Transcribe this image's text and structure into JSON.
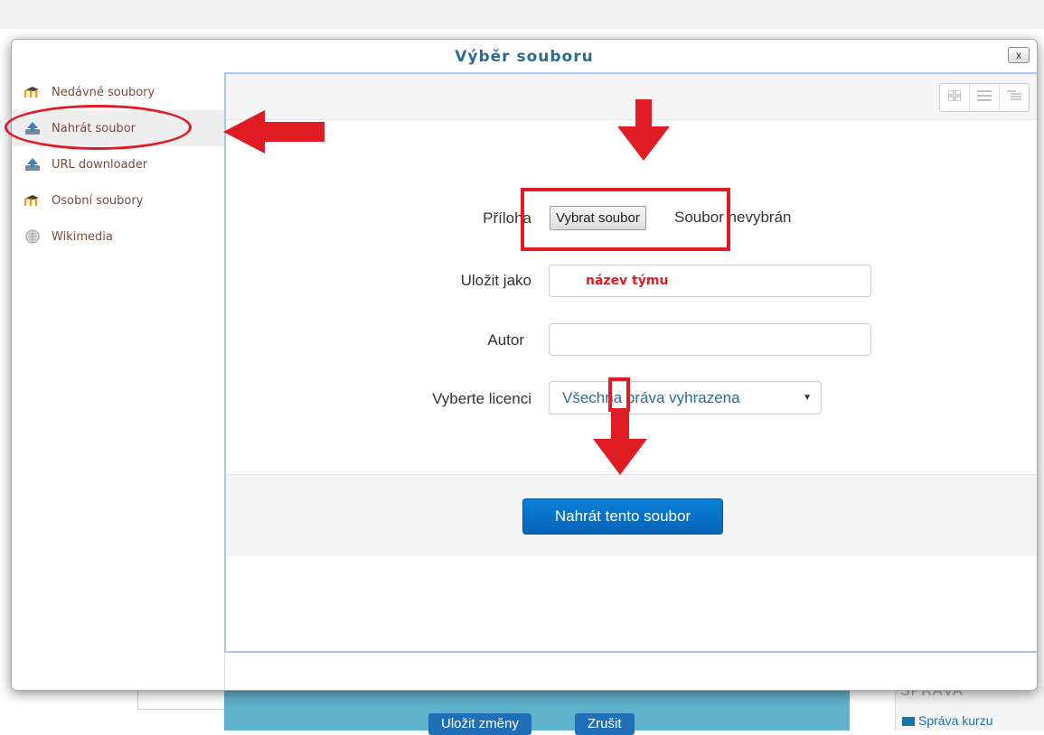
{
  "dialog": {
    "title": "Výběr souboru",
    "close_label": "x"
  },
  "sidebar": {
    "items": [
      {
        "label": "Nedávné soubory",
        "icon": "moodle-icon"
      },
      {
        "label": "Nahrát soubor",
        "icon": "upload-icon",
        "active": true
      },
      {
        "label": "URL downloader",
        "icon": "upload-icon"
      },
      {
        "label": "Osobní soubory",
        "icon": "moodle-icon"
      },
      {
        "label": "Wikimedia",
        "icon": "wikimedia-icon"
      }
    ]
  },
  "toolbar": {
    "views": [
      "icons-view-icon",
      "list-view-icon",
      "tree-view-icon"
    ]
  },
  "form": {
    "attachment_label": "Příloha",
    "choose_file_label": "Vybrat soubor",
    "file_status": "Soubor nevybrán",
    "save_as_label": "Uložit jako",
    "save_as_value": "název týmu",
    "author_label": "Autor",
    "author_value": "",
    "license_label": "Vyberte licenci",
    "license_value": "Všechna práva vyhrazena",
    "submit_label": "Nahrát tento soubor"
  },
  "background": {
    "save_changes_label": "Uložit změny",
    "cancel_label": "Zrušit",
    "admin_title": "SPRÁVA",
    "admin_item": "Správa kurzu"
  },
  "colors": {
    "accent_blue": "#0564b8",
    "annotation_red": "#e01b24",
    "title_blue": "#2b6b93"
  }
}
